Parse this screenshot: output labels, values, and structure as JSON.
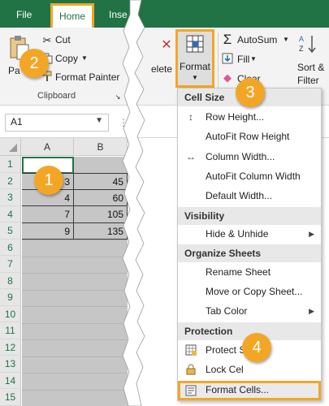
{
  "ribbon": {
    "tabs": [
      "File",
      "Home",
      "Inse"
    ],
    "clipboard": {
      "paste_label": "Pa",
      "cut_label": "Cut",
      "copy_label": "Copy",
      "format_painter_label": "Format Painter",
      "caption": "Clipboard"
    },
    "delete_label": "elete",
    "format_label": "Format",
    "editing": {
      "autosum_label": "AutoSum",
      "fill_label": "Fill",
      "clear_label": "Clear",
      "sort_filter_label_1": "Sort &",
      "sort_filter_label_2": "Filter"
    }
  },
  "name_box": {
    "value": "A1"
  },
  "grid": {
    "columns": [
      "A",
      "B"
    ],
    "rows": [
      "1",
      "2",
      "3",
      "4",
      "5",
      "6",
      "7",
      "8",
      "9",
      "10",
      "11",
      "12",
      "13",
      "14",
      "15"
    ],
    "cells": [
      {
        "a": "3",
        "b": "45"
      },
      {
        "a": "4",
        "b": "60"
      },
      {
        "a": "7",
        "b": "105"
      },
      {
        "a": "9",
        "b": "135"
      }
    ]
  },
  "menu": {
    "sections": [
      {
        "title": "Cell Size",
        "items": [
          {
            "label": "Row Height...",
            "icon": "row-height-icon"
          },
          {
            "label": "AutoFit Row Height",
            "icon": ""
          },
          {
            "label": "Column Width...",
            "icon": "column-width-icon"
          },
          {
            "label": "AutoFit Column Width",
            "icon": ""
          },
          {
            "label": "Default Width...",
            "icon": ""
          }
        ]
      },
      {
        "title": "Visibility",
        "items": [
          {
            "label": "Hide & Unhide",
            "icon": "",
            "submenu": true
          }
        ]
      },
      {
        "title": "Organize Sheets",
        "items": [
          {
            "label": "Rename Sheet",
            "icon": ""
          },
          {
            "label": "Move or Copy Sheet...",
            "icon": ""
          },
          {
            "label": "Tab Color",
            "icon": "",
            "submenu": true
          }
        ]
      },
      {
        "title": "Protection",
        "items": [
          {
            "label": "Protect S",
            "icon": "protect-sheet-icon"
          },
          {
            "label": "Lock Cel",
            "icon": "lock-cell-icon"
          },
          {
            "label": "Format Cells...",
            "icon": "format-cells-icon"
          }
        ]
      }
    ]
  },
  "callouts": [
    "1",
    "2",
    "3",
    "4"
  ],
  "colors": {
    "excel_green": "#217346",
    "highlight_orange": "#f3a626",
    "selection_gray": "#c6c6c6"
  }
}
